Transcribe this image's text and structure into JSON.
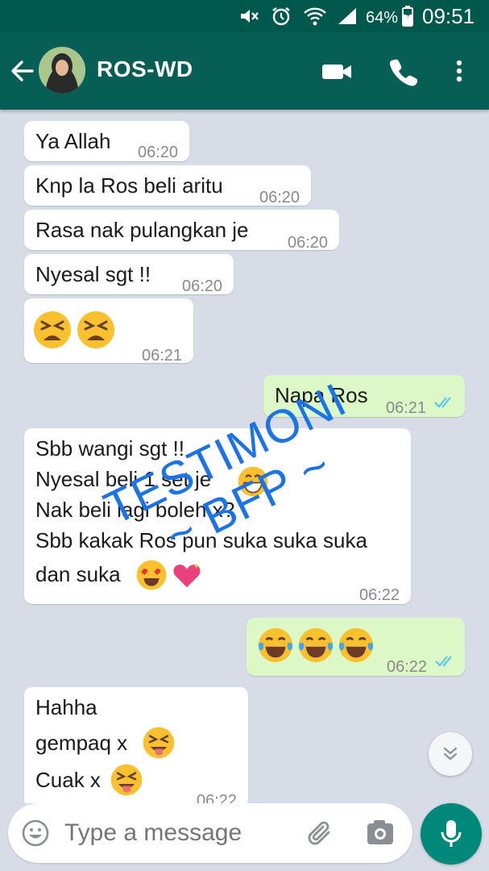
{
  "status_bar": {
    "battery": "64%",
    "time": "09:51",
    "icons": [
      "mute-icon",
      "alarm-icon",
      "wifi-icon",
      "signal-icon",
      "battery-icon"
    ]
  },
  "header": {
    "contact_name": "ROS-WD",
    "icons": [
      "back-arrow-icon",
      "avatar",
      "video-call-icon",
      "phone-icon",
      "more-vert-icon"
    ]
  },
  "messages": [
    {
      "id": "m1",
      "text": "Ya Allah",
      "time": "06:20",
      "direction": "incoming"
    },
    {
      "id": "m2",
      "text": "Knp la Ros beli aritu",
      "time": "06:20",
      "direction": "incoming"
    },
    {
      "id": "m3",
      "text": "Rasa nak pulangkan je",
      "time": "06:20",
      "direction": "incoming"
    },
    {
      "id": "m4",
      "text": "Nyesal sgt !!",
      "time": "06:20",
      "direction": "incoming"
    },
    {
      "id": "m5",
      "emojis": [
        "tired-face-emoji",
        "tired-face-emoji"
      ],
      "time": "06:21",
      "direction": "incoming"
    },
    {
      "id": "m6",
      "text": "Napa Ros",
      "time": "06:21",
      "direction": "outgoing",
      "status": "read"
    },
    {
      "id": "m7",
      "lines": [
        "Sbb wangi sgt !!",
        "Nyesal beli 1 set je",
        "Nak beli lagi boleh x?",
        "Sbb kakak Ros pun suka suka suka",
        "dan suka"
      ],
      "time": "06:22",
      "direction": "incoming"
    },
    {
      "id": "m8",
      "emojis": [
        "tears-of-joy-emoji",
        "tears-of-joy-emoji",
        "tears-of-joy-emoji"
      ],
      "time": "06:22",
      "direction": "outgoing",
      "status": "read"
    },
    {
      "id": "m9",
      "lines": [
        "Hahha",
        "gempaq x",
        "Cuak x"
      ],
      "time": "06:22",
      "direction": "incoming"
    }
  ],
  "watermark": {
    "line1": "TESTIMONI",
    "line2": "~ BFP ~",
    "color": "#1a73e8"
  },
  "input": {
    "placeholder": "Type a message",
    "icons": [
      "emoji-icon",
      "attach-icon",
      "camera-icon",
      "mic-icon"
    ]
  },
  "colors": {
    "header": "#075e54",
    "status_bar": "#00574b",
    "chat_background": "#d7dce6",
    "outgoing_bubble": "#dcf8c6",
    "incoming_bubble": "#ffffff",
    "read_ticks": "#4fc3f7",
    "mic_button": "#00897b"
  }
}
